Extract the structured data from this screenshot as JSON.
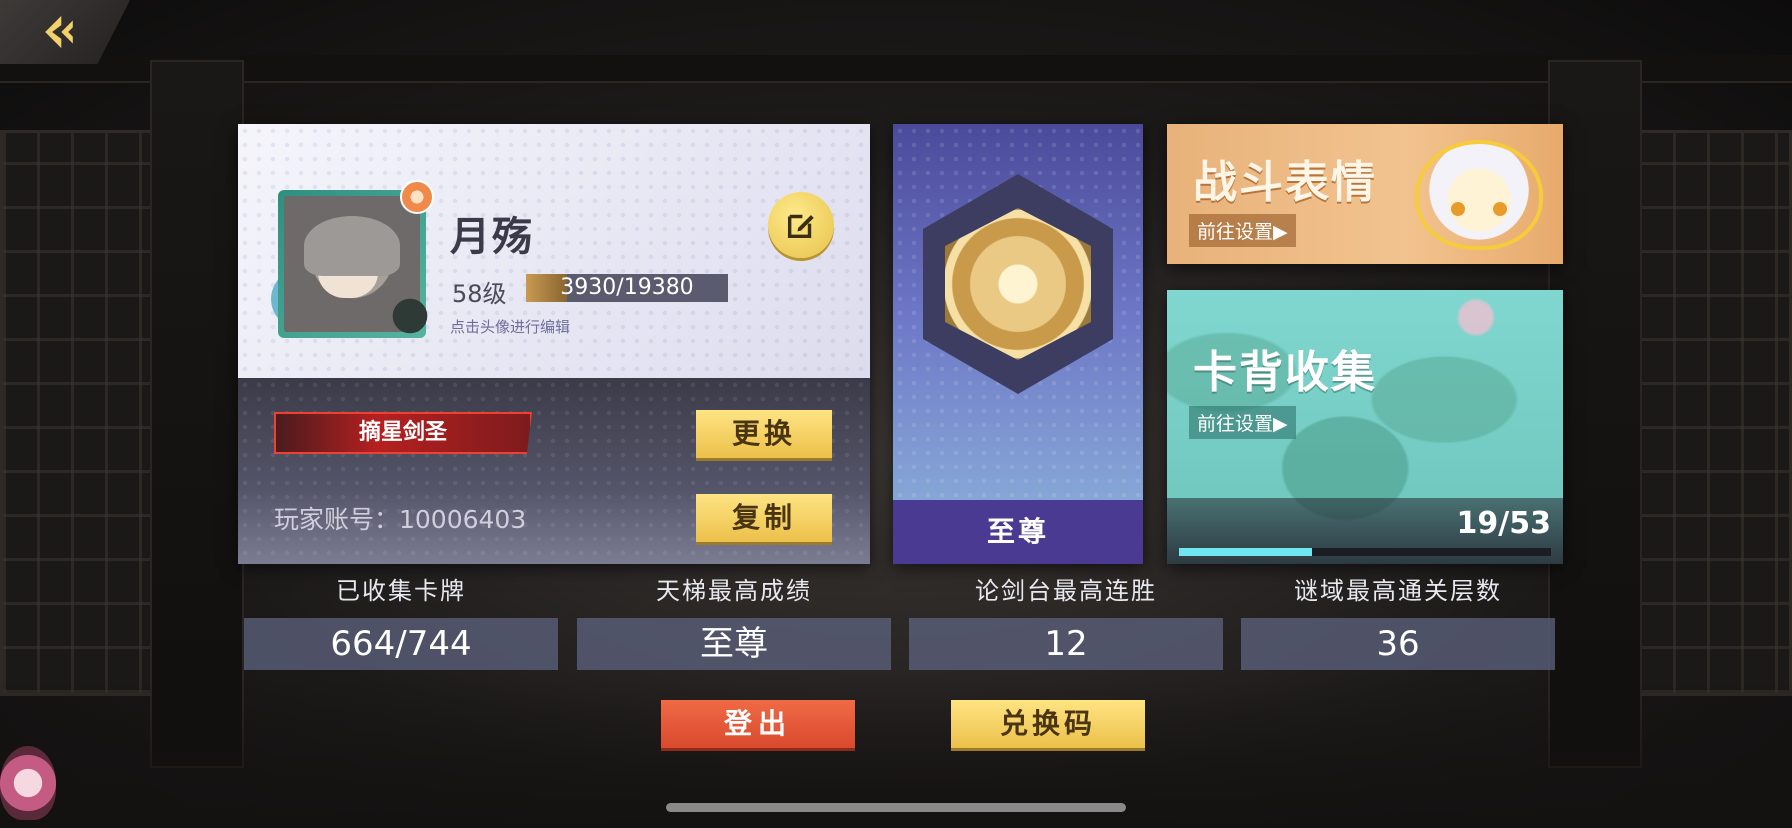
{
  "profile": {
    "name": "月殇",
    "level": "58级",
    "xp_text": "3930/19380",
    "xp_fraction": 0.203,
    "hint": "点击头像进行编辑",
    "title_badge": "摘星剑圣",
    "change_label": "更换",
    "account_text": "玩家账号：10006403",
    "copy_label": "复制"
  },
  "rank": {
    "name": "至尊"
  },
  "banners": {
    "emote": {
      "title": "战斗表情",
      "link": "前往设置▶"
    },
    "cardback": {
      "title": "卡背收集",
      "link": "前往设置▶",
      "count": "19/53",
      "fraction": 0.358
    }
  },
  "stats": [
    {
      "label": "已收集卡牌",
      "value": "664/744"
    },
    {
      "label": "天梯最高成绩",
      "value": "至尊"
    },
    {
      "label": "论剑台最高连胜",
      "value": "12"
    },
    {
      "label": "谜域最高通关层数",
      "value": "36"
    }
  ],
  "actions": {
    "logout": "登出",
    "redeem": "兑换码"
  },
  "colors": {
    "accent_yellow": "#ebc04a",
    "logout_red": "#d94a2e",
    "rank_purple": "#4a3a92",
    "progress_cyan": "#6fe6f2"
  }
}
